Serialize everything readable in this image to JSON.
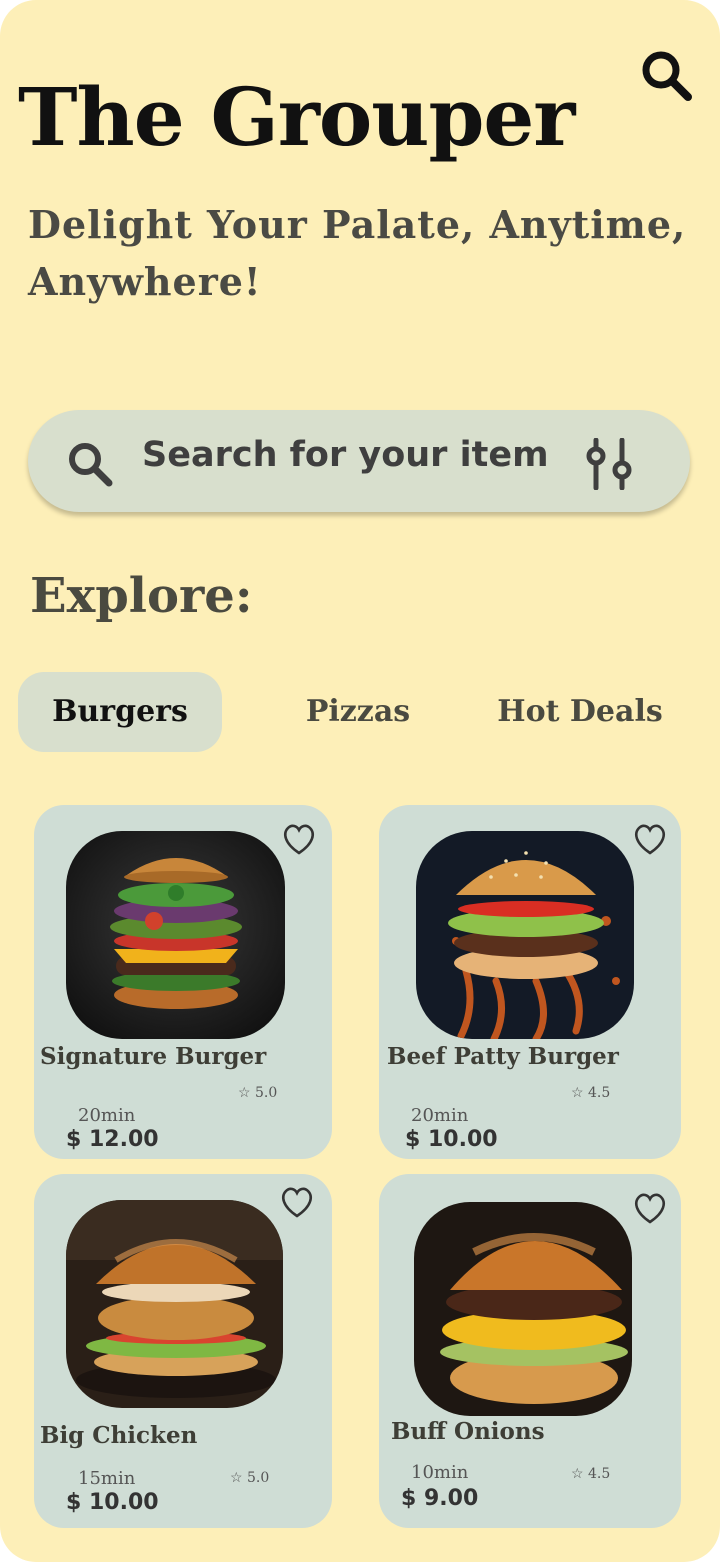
{
  "app": {
    "title": "The Grouper",
    "tagline": "Delight Your Palate, Anytime, Anywhere!"
  },
  "header": {
    "search_icon": "search-icon"
  },
  "search": {
    "placeholder": "Search for your item",
    "search_icon": "search-icon",
    "filter_icon": "filter-sliders-icon"
  },
  "explore": {
    "heading": "Explore:",
    "tabs": [
      {
        "label": "Burgers",
        "active": true
      },
      {
        "label": "Pizzas",
        "active": false
      },
      {
        "label": "Hot Deals",
        "active": false
      }
    ]
  },
  "items": [
    {
      "name": "Signature Burger",
      "rating": "5.0",
      "time": "20min",
      "price": "$ 12.00",
      "icon": "heart-icon"
    },
    {
      "name": "Beef Patty Burger",
      "rating": "4.5",
      "time": "20min",
      "price": "$ 10.00",
      "icon": "heart-icon"
    },
    {
      "name": "Big Chicken",
      "rating": "5.0",
      "time": "15min",
      "price": "$ 10.00",
      "icon": "heart-icon"
    },
    {
      "name": "Buff Onions",
      "rating": "4.5",
      "time": "10min",
      "price": "$ 9.00",
      "icon": "heart-icon"
    }
  ],
  "colors": {
    "background": "#fdefb8",
    "search_bar": "#d8dfcd",
    "card": "#cfddd5",
    "active_tab": "#d8dfcd"
  }
}
